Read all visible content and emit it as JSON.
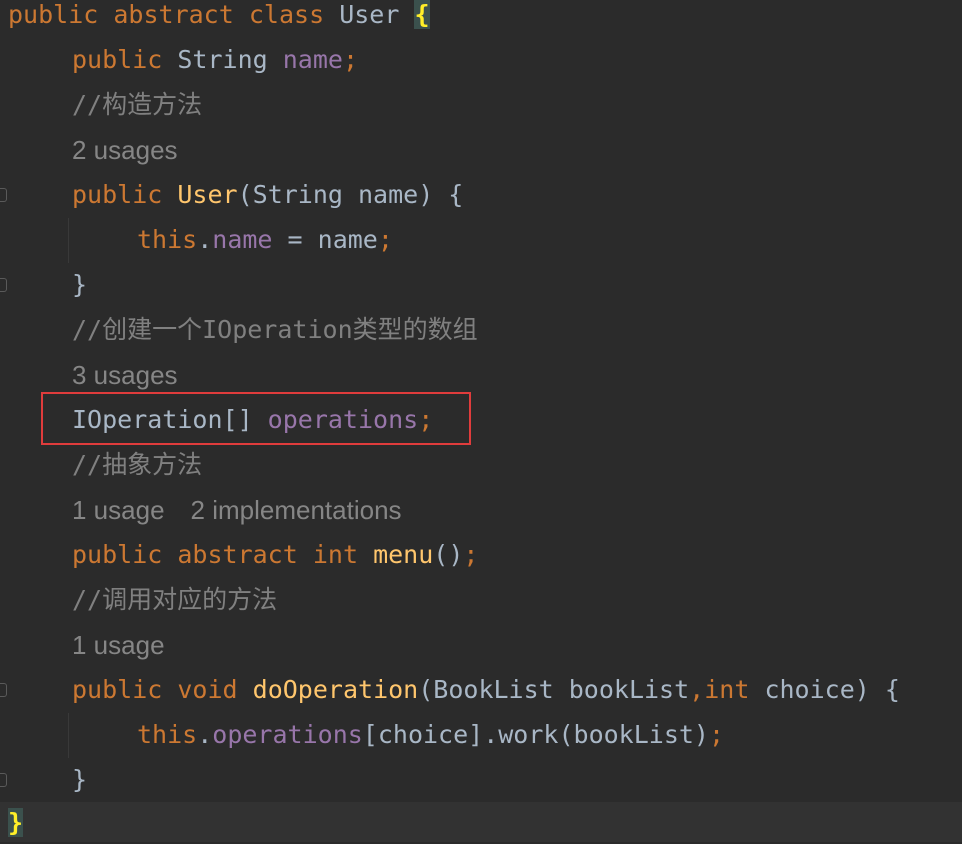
{
  "editor": {
    "lines": [
      {
        "kw1": "public",
        "kw2": "abstract",
        "kw3": "class",
        "name": "User",
        "brace": "{"
      },
      {
        "kw": "public",
        "type": "String",
        "field": "name",
        "semi": ";"
      },
      {
        "comment": "//构造方法"
      },
      {
        "inlay": "2 usages"
      },
      {
        "kw": "public",
        "name": "User",
        "params": "(String name) {"
      },
      {
        "kw": "this",
        "dot": ".",
        "field": "name",
        "rest": " = name",
        "semi": ";"
      },
      {
        "text": "}"
      },
      {
        "comment": "//创建一个IOperation类型的数组"
      },
      {
        "inlay": "3 usages"
      },
      {
        "type": "IOperation[] ",
        "field": "operations",
        "semi": ";"
      },
      {
        "comment": "//抽象方法"
      },
      {
        "inlay": "1 usage",
        "inlay2": "2 implementations"
      },
      {
        "kw1": "public",
        "kw2": "abstract",
        "kw3": "int",
        "name": "menu",
        "rest": "()",
        "semi": ";"
      },
      {
        "comment": "//调用对应的方法"
      },
      {
        "inlay": "1 usage"
      },
      {
        "kw1": "public",
        "kw2": "void",
        "name": "doOperation",
        "p1": "(BookList bookList",
        "comma": ",",
        "kw3": "int",
        "p2": " choice) {"
      },
      {
        "kw": "this",
        "dot": ".",
        "field": "operations",
        "rest": "[choice].work(bookList)",
        "semi": ";"
      },
      {
        "text": "}"
      },
      {
        "brace": "}"
      }
    ]
  },
  "colors": {
    "background": "#2b2b2b",
    "keyword": "#cc7832",
    "field": "#9876aa",
    "method": "#ffc66d",
    "comment": "#808080",
    "plain": "#a9b7c6",
    "highlight_box": "#e03c3c"
  }
}
